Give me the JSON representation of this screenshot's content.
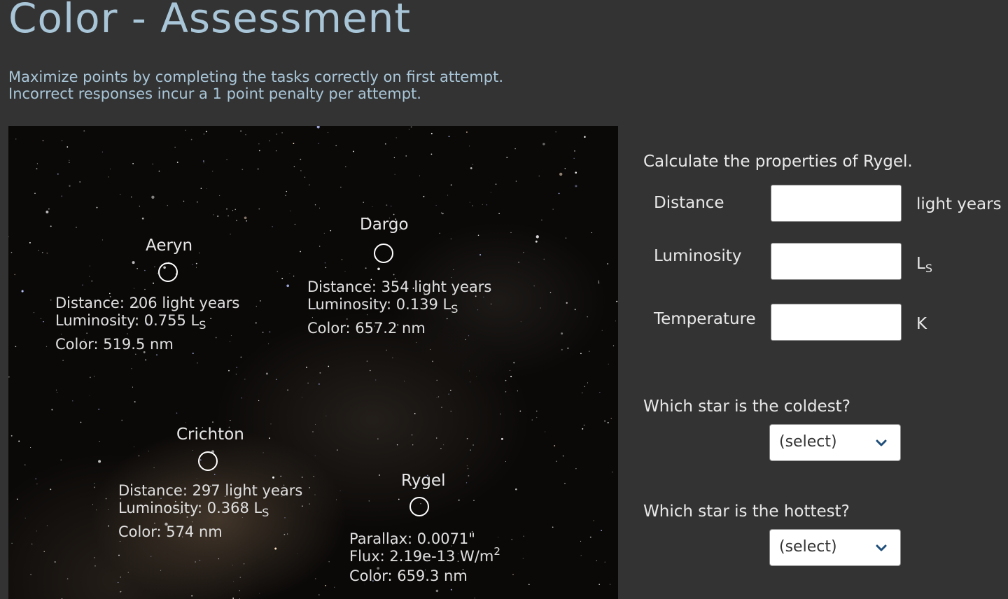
{
  "header": {
    "title": "Color - Assessment",
    "instructions": [
      "Maximize points by completing the tasks correctly on first attempt.",
      "Incorrect responses incur a 1 point penalty per attempt."
    ]
  },
  "stars": {
    "aeryn": {
      "name": "Aeryn",
      "distance": "Distance:  206 light years",
      "luminosity": "Luminosity:  0.755 L",
      "color": "Color:  519.5 nm"
    },
    "dargo": {
      "name": "Dargo",
      "distance": "Distance:  354 light years",
      "luminosity": "Luminosity:  0.139 L",
      "color": "Color:  657.2 nm"
    },
    "crichton": {
      "name": "Crichton",
      "distance": "Distance: 297 light years",
      "luminosity": "Luminosity: 0.368 L",
      "color": "Color: 574 nm"
    },
    "rygel": {
      "name": "Rygel",
      "parallax": "Parallax:  0.0071\"",
      "flux": "Flux:  2.19e-13 W/m",
      "flux_exponent": "2",
      "color": "Color:  659.3 nm"
    },
    "solar_subscript": "S"
  },
  "panel": {
    "heading": "Calculate the properties of Rygel.",
    "fields": {
      "distance": {
        "label": "Distance",
        "value": "",
        "unit": "light years"
      },
      "luminosity": {
        "label": "Luminosity",
        "value": "",
        "unit_base": "L",
        "unit_sub": "S"
      },
      "temperature": {
        "label": "Temperature",
        "value": "",
        "unit": "K"
      }
    },
    "coldest": {
      "question": "Which star is the coldest?",
      "selected": "(select)"
    },
    "hottest": {
      "question": "Which star is the hottest?",
      "selected": "(select)"
    }
  },
  "colors": {
    "title": "#a9c6d8",
    "background": "#333333",
    "chevron": "#1f4f7a"
  },
  "icons": {
    "dropdown": "chevron-down-icon",
    "star_marker": "circle-outline-icon"
  }
}
